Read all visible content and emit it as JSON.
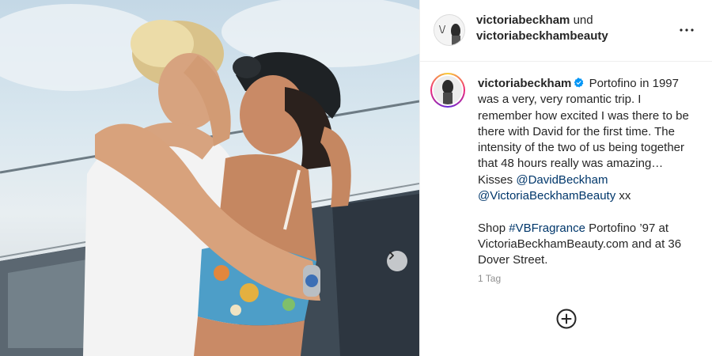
{
  "post": {
    "header": {
      "author_primary": "victoriabeckham",
      "connector": "und",
      "author_secondary": "victoriabeckhambeauty"
    },
    "caption": {
      "username": "victoriabeckham",
      "text_1": "Portofino in 1997 was a very, very romantic trip. I remember how excited I was there to be there with David for the first time. The intensity of the two of us being together that 48 hours really was amazing… Kisses",
      "mention_1": "@DavidBeckham",
      "mention_2": "@VictoriaBeckhamBeauty",
      "text_2": "xx",
      "shop_prefix": "Shop",
      "hashtag": "#VBFragrance",
      "shop_text": "Portofino ’97 at VictoriaBeckhamBeauty.com and at 36 Dover Street."
    },
    "timestamp": "1 Tag"
  },
  "colors": {
    "link": "#00376b",
    "verified": "#0095f6",
    "muted": "#8e8e8e",
    "text": "#262626"
  },
  "icons": {
    "verified": "verified-badge-icon",
    "more": "more-options-icon",
    "next": "chevron-right-icon",
    "add": "add-circle-icon"
  }
}
